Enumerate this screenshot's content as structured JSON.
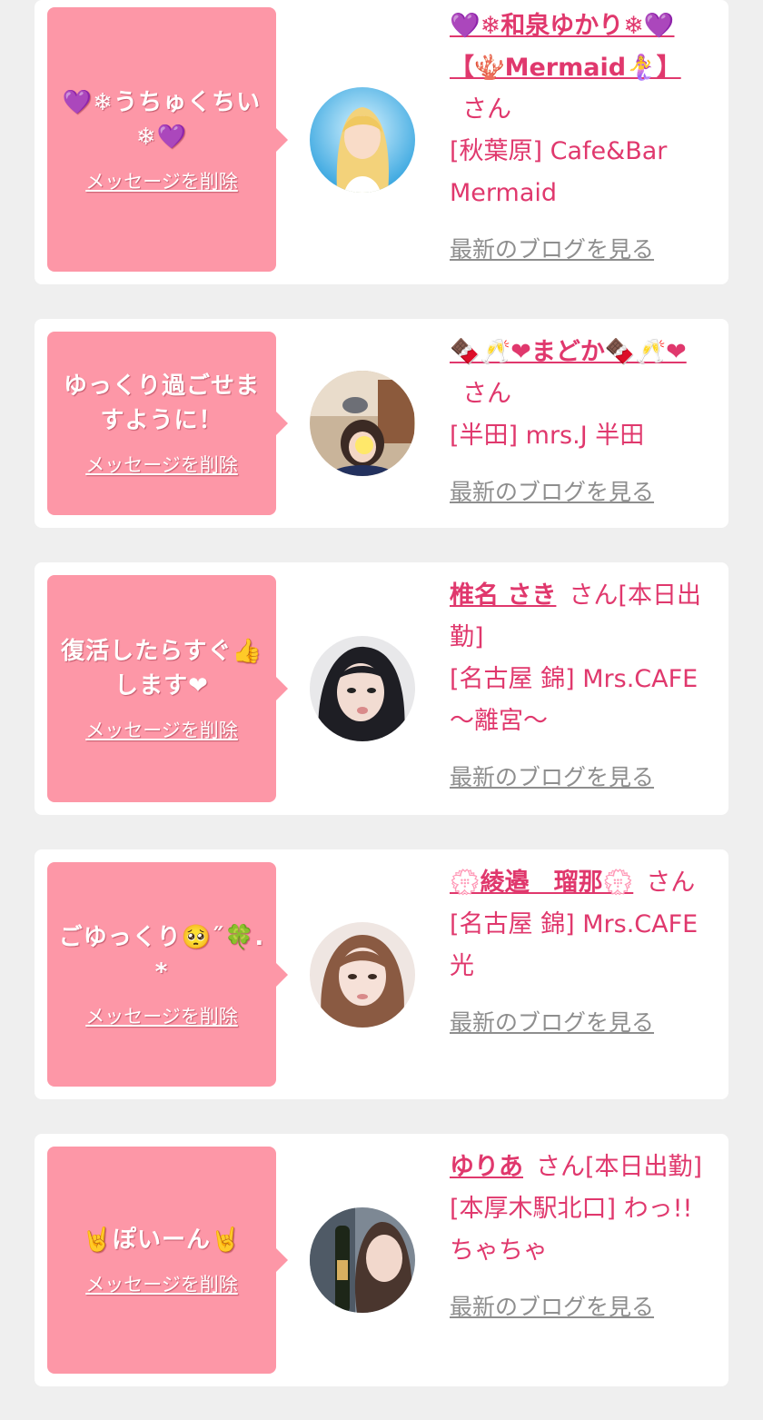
{
  "cards": [
    {
      "message": "💜❄うちゅくちい❄💜",
      "delete_label": "メッセージを削除",
      "name": "💜❄和泉ゆかり❄💜【🪸Mermaid🧜‍♀️】",
      "san": "さん",
      "shop": "[秋葉原] Cafe&Bar Mermaid",
      "blog_label": "最新のブログを見る"
    },
    {
      "message": "ゆっくり過ごせますように！",
      "delete_label": "メッセージを削除",
      "name": "🍫🥂❤まどか🍫🥂❤",
      "san": "さん",
      "shop": "[半田] mrs.J 半田",
      "blog_label": "最新のブログを見る"
    },
    {
      "message": "復活したらすぐ👍します❤",
      "delete_label": "メッセージを削除",
      "name": "椎名 さき",
      "san": "さん[本日出勤]",
      "shop": "[名古屋 錦] Mrs.CAFE 〜離宮〜",
      "blog_label": "最新のブログを見る"
    },
    {
      "message": "ごゆっくり🥺˝🍀.*",
      "delete_label": "メッセージを削除",
      "name": "💮綾邉　瑠那💮",
      "san": "さん",
      "shop": "[名古屋 錦] Mrs.CAFE 光",
      "blog_label": "最新のブログを見る"
    },
    {
      "message": "🤘ぽいーん🤘",
      "delete_label": "メッセージを削除",
      "name": "ゆりあ",
      "san": "さん[本日出勤]",
      "shop": "[本厚木駅北口] わっ!!ちゃちゃ",
      "blog_label": "最新のブログを見る"
    }
  ],
  "colors": {
    "background": "#efefef",
    "bubble": "#fd97a7",
    "accent_text": "#e0386d",
    "blog_link": "#8e8e8e"
  }
}
